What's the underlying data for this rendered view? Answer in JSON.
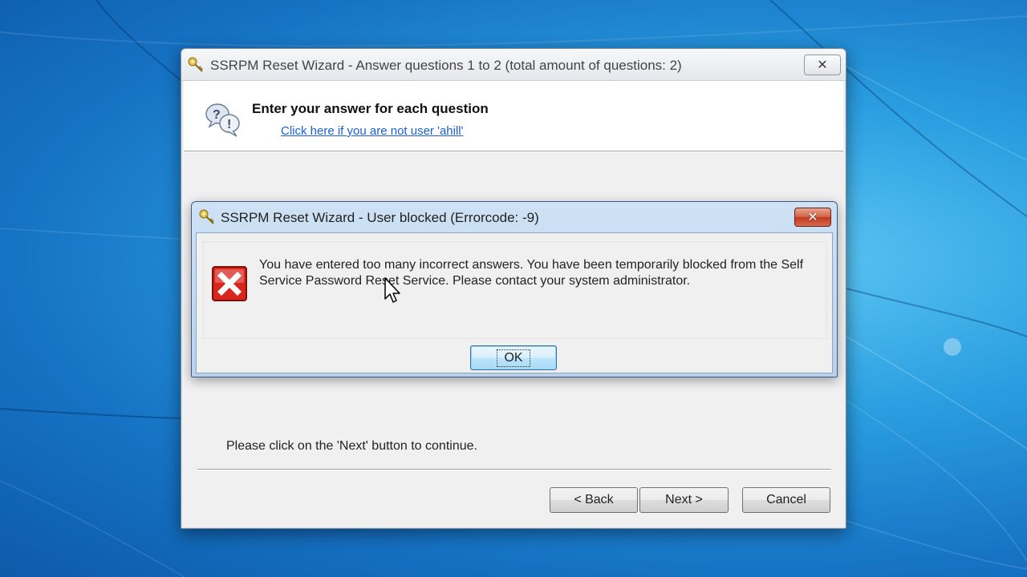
{
  "colors": {
    "desktop": "#1e88d6",
    "link": "#1a5fd6",
    "error_red": "#d9261c"
  },
  "wizard": {
    "title": "SSRPM Reset Wizard - Answer questions 1 to 2 (total amount of questions: 2)",
    "close_label": "✕",
    "header": {
      "title": "Enter your answer for each question",
      "link": "Click here if you are not user 'ahill'"
    },
    "continue_text": "Please click on the 'Next' button to continue.",
    "buttons": {
      "back": "< Back",
      "next": "Next >",
      "cancel": "Cancel"
    }
  },
  "error_dialog": {
    "title": "SSRPM Reset Wizard - User blocked (Errorcode: -9)",
    "close_label": "✕",
    "message": "You have entered too many incorrect answers. You have been temporarily blocked from the Self Service Password Reset Service. Please contact your system administrator.",
    "ok_label": "OK"
  },
  "icons": {
    "title": "keys-icon",
    "header": "question-bubbles-icon",
    "error": "error-x-icon",
    "cursor": "mouse-cursor-icon"
  }
}
